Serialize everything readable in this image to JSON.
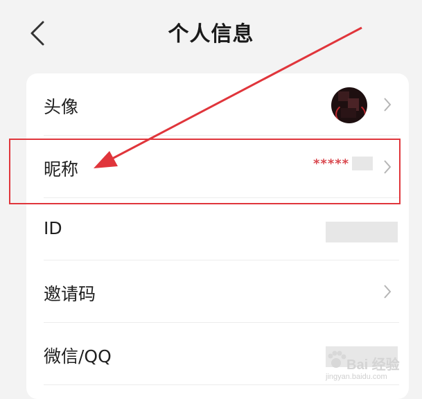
{
  "header": {
    "title": "个人信息",
    "back_icon": "chevron-left-icon"
  },
  "rows": [
    {
      "key": "avatar",
      "label": "头像"
    },
    {
      "key": "nickname",
      "label": "昵称",
      "value": "*****"
    },
    {
      "key": "id",
      "label": "ID"
    },
    {
      "key": "invite",
      "label": "邀请码"
    },
    {
      "key": "wechat_qq",
      "label": "微信/QQ"
    }
  ],
  "annotation": {
    "highlight_color": "#e0353b",
    "arrow_color": "#e0353b"
  },
  "watermark": {
    "text": "Bai 经验",
    "subtext": "jingyan.baidu.com"
  },
  "colors": {
    "background": "#f3f3f3",
    "card": "#ffffff",
    "masked_text": "#d9484f"
  }
}
